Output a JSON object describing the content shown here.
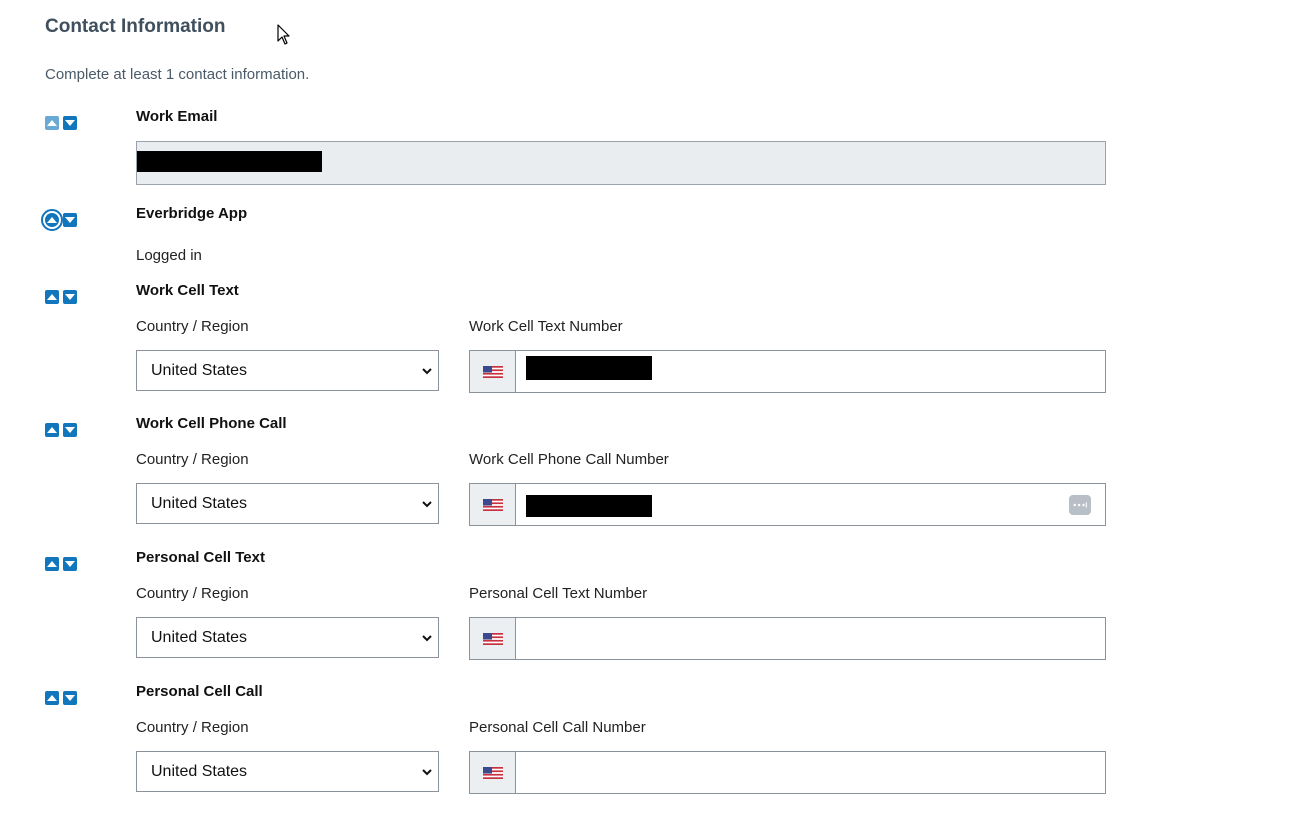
{
  "header": {
    "title": "Contact Information",
    "subtitle": "Complete at least 1 contact information."
  },
  "colors": {
    "accent": "#1176bc",
    "accent_disabled": "#6aa9d6",
    "readonly_bg": "#e9edf0"
  },
  "work_email": {
    "title": "Work Email"
  },
  "everbridge_app": {
    "title": "Everbridge App",
    "status": "Logged in"
  },
  "work_cell_text": {
    "title": "Work Cell Text",
    "country_label": "Country / Region",
    "country_value": "United States",
    "number_label": "Work Cell Text Number"
  },
  "work_cell_phone_call": {
    "title": "Work Cell Phone Call",
    "country_label": "Country / Region",
    "country_value": "United States",
    "number_label": "Work Cell Phone Call Number"
  },
  "personal_cell_text": {
    "title": "Personal Cell Text",
    "country_label": "Country / Region",
    "country_value": "United States",
    "number_label": "Personal Cell Text Number"
  },
  "personal_cell_call": {
    "title": "Personal Cell Call",
    "country_label": "Country / Region",
    "country_value": "United States",
    "number_label": "Personal Cell Call Number"
  },
  "icons": {
    "move_up": "chevron-up-icon",
    "move_down": "chevron-down-icon",
    "flag": "us-flag-icon",
    "password_manager": "password-manager-icon",
    "cursor": "mouse-cursor-icon"
  }
}
